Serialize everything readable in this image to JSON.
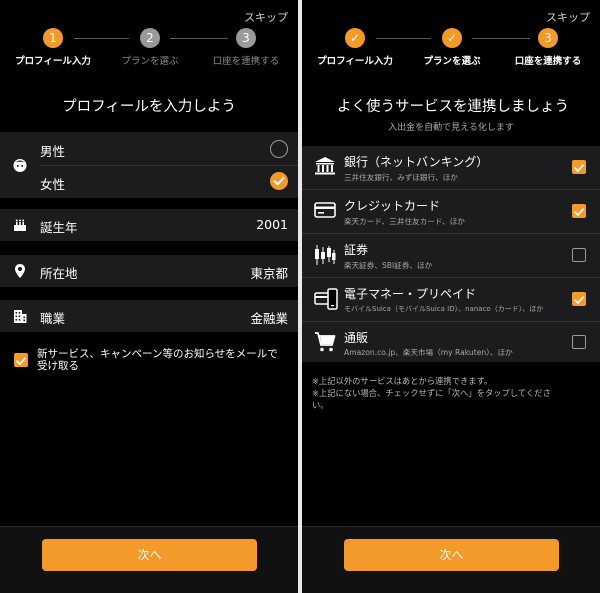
{
  "colors": {
    "accent": "#f39a2b",
    "background": "#000000",
    "row": "#1c1c1e"
  },
  "left": {
    "skip": "スキップ",
    "steps": [
      {
        "num": "1",
        "label": "プロフィール入力",
        "state": "active"
      },
      {
        "num": "2",
        "label": "プランを選ぶ",
        "state": "pending"
      },
      {
        "num": "3",
        "label": "口座を連携する",
        "state": "pending"
      }
    ],
    "heading": "プロフィールを入力しよう",
    "gender": {
      "icon": "face-icon",
      "options": [
        {
          "label": "男性",
          "selected": false
        },
        {
          "label": "女性",
          "selected": true
        }
      ]
    },
    "birth_year": {
      "icon": "cake-icon",
      "label": "誕生年",
      "value": "2001"
    },
    "location": {
      "icon": "location-pin-icon",
      "label": "所在地",
      "value": "東京都"
    },
    "occupation": {
      "icon": "building-icon",
      "label": "職業",
      "value": "金融業"
    },
    "newsletter": {
      "label": "新サービス、キャンペーン等のお知らせをメールで受け取る",
      "checked": true
    },
    "next": "次へ"
  },
  "right": {
    "skip": "スキップ",
    "steps": [
      {
        "num": "✓",
        "label": "プロフィール入力",
        "state": "done"
      },
      {
        "num": "✓",
        "label": "プランを選ぶ",
        "state": "done"
      },
      {
        "num": "3",
        "label": "口座を連携する",
        "state": "active"
      }
    ],
    "heading": "よく使うサービスを連携しましょう",
    "subheading": "入出金を自動で見える化します",
    "services": [
      {
        "icon": "bank-icon",
        "title": "銀行（ネットバンキング）",
        "sub": "三井住友銀行、みずほ銀行、ほか",
        "checked": true
      },
      {
        "icon": "credit-card-icon",
        "title": "クレジットカード",
        "sub": "楽天カード、三井住友カード、ほか",
        "checked": true
      },
      {
        "icon": "candlestick-chart-icon",
        "title": "証券",
        "sub": "楽天証券、SBI証券、ほか",
        "checked": false
      },
      {
        "icon": "e-money-icon",
        "title": "電子マネー・プリペイド",
        "sub": "モバイルSuica（モバイルSuica ID）、nanaco（カード）、ほか",
        "checked": true
      },
      {
        "icon": "cart-icon",
        "title": "通販",
        "sub": "Amazon.co.jp、楽天市場（my Rakuten）、ほか",
        "checked": false
      }
    ],
    "notes": [
      "※上記以外のサービスはあとから連携できます。",
      "※上記にない場合、チェックせずに「次へ」をタップしてください。"
    ],
    "next": "次へ"
  }
}
